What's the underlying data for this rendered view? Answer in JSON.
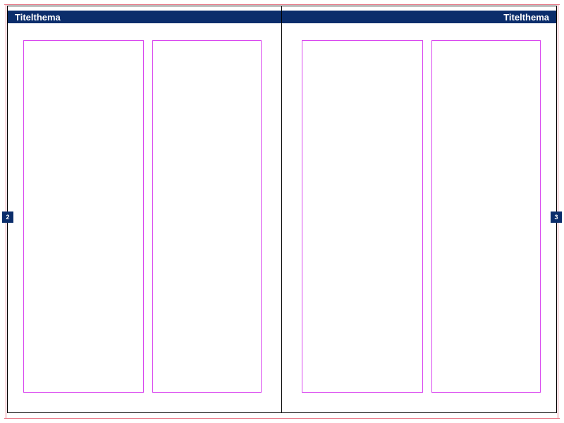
{
  "pages": {
    "left": {
      "header_title": "Titelthema",
      "page_number": "2"
    },
    "right": {
      "header_title": "Titelthema",
      "page_number": "3"
    }
  },
  "colors": {
    "header_bg": "#0b2d6b",
    "guide": "#d946ef",
    "bleed": "#e97b8a"
  }
}
